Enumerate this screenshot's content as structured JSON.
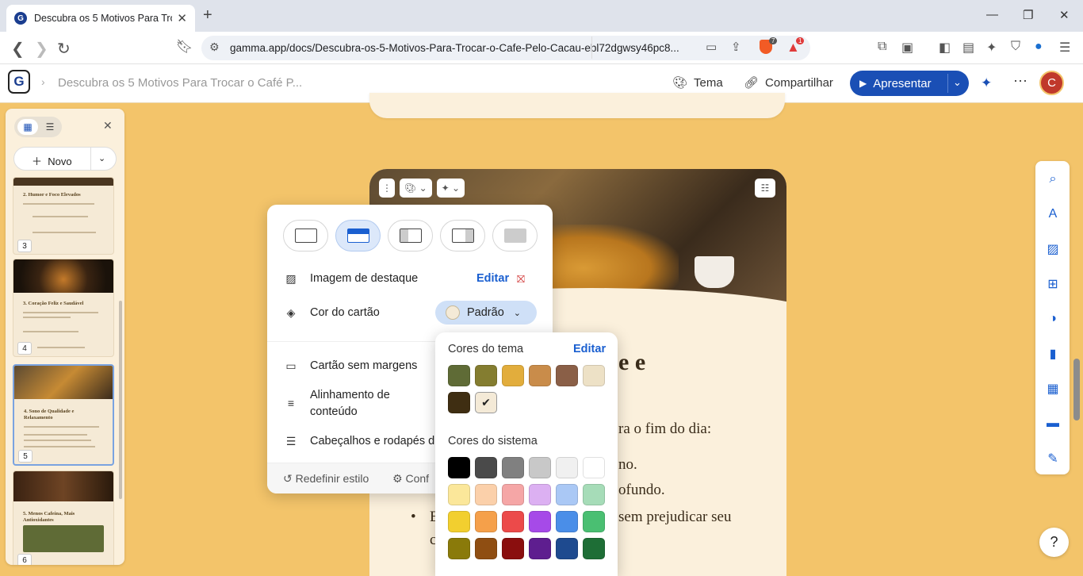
{
  "browser": {
    "tab_title": "Descubra os 5 Motivos Para Troc",
    "url": "gamma.app/docs/Descubra-os-5-Motivos-Para-Trocar-o-Cafe-Pelo-Cacau-ebl72dgwsy46pc8...",
    "brave_badge": "7",
    "alert_badge": "1"
  },
  "header": {
    "breadcrumb": "Descubra os 5 Motivos Para Trocar o Café P...",
    "theme_label": "Tema",
    "share_label": "Compartilhar",
    "present_label": "Apresentar",
    "avatar_initial": "C"
  },
  "sidebar": {
    "new_label": "Novo",
    "thumbnails": [
      {
        "num": "3",
        "title": "2. Humor e Foco Elevados"
      },
      {
        "num": "4",
        "title": "3. Coração Feliz e Saudável"
      },
      {
        "num": "5",
        "title": "4. Sono de Qualidade e Relaxamento"
      },
      {
        "num": "6",
        "title": "5. Menos Cafeína, Mais Antioxidantes"
      }
    ]
  },
  "document": {
    "heading_fragment": "e e",
    "line1": "ra o fim do dia:",
    "line2": "no.",
    "line3": "ofundo.",
    "line4": "sem prejudicar seu",
    "bullet_marker": "•",
    "bullet_prefix": "E",
    "line5_prefix": "c"
  },
  "popup": {
    "featured_image_label": "Imagem de destaque",
    "edit_label": "Editar",
    "card_color_label": "Cor do cartão",
    "card_color_value": "Padrão",
    "borderless_label": "Cartão sem margens",
    "alignment_label_1": "Alinhamento de",
    "alignment_label_2": "conteúdo",
    "headers_footers_label": "Cabeçalhos e rodapés d",
    "reset_label": "Redefinir estilo",
    "config_label": "Conf"
  },
  "color_picker": {
    "theme_colors_label": "Cores do tema",
    "edit_label": "Editar",
    "system_colors_label": "Cores do sistema",
    "theme_colors": [
      "#5f6b36",
      "#847d30",
      "#e2ad3c",
      "#c98c4a",
      "#8a5f47",
      "#ede1c6",
      "#3f2e12",
      "#f4ead7"
    ],
    "selected_index": 7,
    "system_colors": [
      "#000000",
      "#4a4a4a",
      "#808080",
      "#c8c8c8",
      "#f0f0f0",
      "#ffffff",
      "#fbe79a",
      "#fbd0aa",
      "#f5a6a6",
      "#dcb0f2",
      "#aac8f5",
      "#a6dcb8",
      "#f2cf2f",
      "#f5a04a",
      "#ec4a4a",
      "#a64ae8",
      "#4a8ee8",
      "#4abf72",
      "#8a7a0a",
      "#8f4e12",
      "#8a0e0e",
      "#5e1e8f",
      "#1e4a8f",
      "#1e6e36"
    ]
  }
}
